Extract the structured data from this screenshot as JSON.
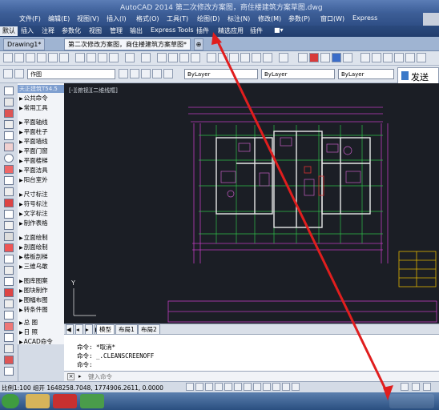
{
  "window": {
    "title": "AutoCAD 2014   第二次修改方案图，商住楼建筑方案草图.dwg"
  },
  "menubar": {
    "items": [
      "文件(F)",
      "编辑(E)",
      "视图(V)",
      "插入(I)",
      "格式(O)",
      "工具(T)",
      "绘图(D)",
      "标注(N)",
      "修改(M)",
      "参数(P)",
      "窗口(W)",
      "Express"
    ]
  },
  "ribbon": {
    "tabs": [
      "默认",
      "插入",
      "注释",
      "参数化",
      "视图",
      "管理",
      "输出",
      "Express Tools",
      "插件",
      "精选应用",
      "插件"
    ]
  },
  "doc_tabs": {
    "tabs": [
      "Drawing1*",
      "第二次修改方案图，商住楼建筑方案草图*"
    ]
  },
  "toolbar2": {
    "workspace": "作图",
    "layer_color": "ByLayer",
    "linetype": "ByLayer",
    "lineweight": "ByLayer",
    "send_label": "发送"
  },
  "tz_panel": {
    "title": "天正建筑T54.5",
    "items": [
      "公共命令",
      "常用工具",
      "平面轴线",
      "平面柱子",
      "平面墙线",
      "平面门窗",
      "平面楼梯",
      "平面洁具",
      "阳台室外",
      "尺寸标注",
      "符号标注",
      "文字标注",
      "制作表格",
      "立面绘制",
      "剖面绘制",
      "楼板剖梯",
      "三维乌敢",
      "图库图案",
      "图块制作",
      "图幅布图",
      "转条件图",
      "总    图",
      "日    照",
      "ACAD命令"
    ]
  },
  "canvas": {
    "viewport_label": "[-][俯视][二维线框]",
    "background": "#1b1e25"
  },
  "layout_tabs": [
    "模型",
    "布局1",
    "布局2"
  ],
  "command": {
    "lines": [
      "命令: *取消*",
      "命令: _.CLEANSCREENOFF",
      "命令:"
    ],
    "input_placeholder": "键入命令"
  },
  "statusbar": {
    "coords": "比例1:100  组开    1648258.7048, 1774906.2611, 0.0000"
  },
  "colors": {
    "arrow": "#e01e1e",
    "menu_bg": "#2f4f86",
    "canvas": "#1b1e25"
  }
}
